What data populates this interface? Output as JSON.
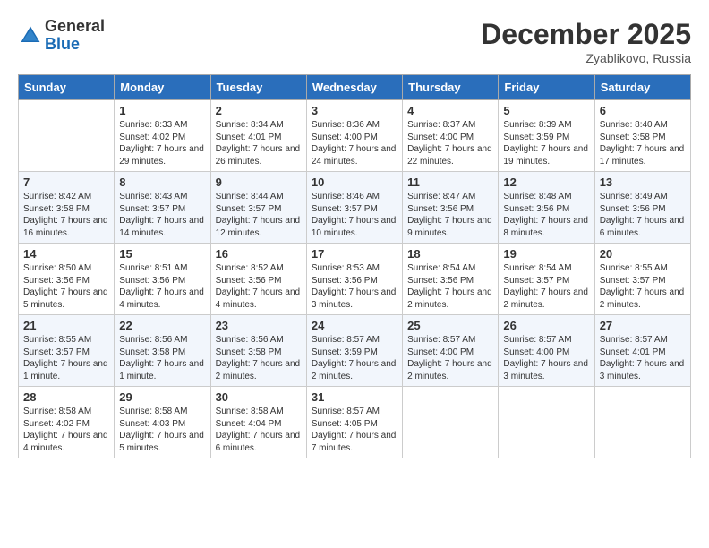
{
  "logo": {
    "general": "General",
    "blue": "Blue"
  },
  "title": "December 2025",
  "location": "Zyablikovo, Russia",
  "days_header": [
    "Sunday",
    "Monday",
    "Tuesday",
    "Wednesday",
    "Thursday",
    "Friday",
    "Saturday"
  ],
  "weeks": [
    [
      {
        "day": "",
        "sunrise": "",
        "sunset": "",
        "daylight": ""
      },
      {
        "day": "1",
        "sunrise": "Sunrise: 8:33 AM",
        "sunset": "Sunset: 4:02 PM",
        "daylight": "Daylight: 7 hours and 29 minutes."
      },
      {
        "day": "2",
        "sunrise": "Sunrise: 8:34 AM",
        "sunset": "Sunset: 4:01 PM",
        "daylight": "Daylight: 7 hours and 26 minutes."
      },
      {
        "day": "3",
        "sunrise": "Sunrise: 8:36 AM",
        "sunset": "Sunset: 4:00 PM",
        "daylight": "Daylight: 7 hours and 24 minutes."
      },
      {
        "day": "4",
        "sunrise": "Sunrise: 8:37 AM",
        "sunset": "Sunset: 4:00 PM",
        "daylight": "Daylight: 7 hours and 22 minutes."
      },
      {
        "day": "5",
        "sunrise": "Sunrise: 8:39 AM",
        "sunset": "Sunset: 3:59 PM",
        "daylight": "Daylight: 7 hours and 19 minutes."
      },
      {
        "day": "6",
        "sunrise": "Sunrise: 8:40 AM",
        "sunset": "Sunset: 3:58 PM",
        "daylight": "Daylight: 7 hours and 17 minutes."
      }
    ],
    [
      {
        "day": "7",
        "sunrise": "Sunrise: 8:42 AM",
        "sunset": "Sunset: 3:58 PM",
        "daylight": "Daylight: 7 hours and 16 minutes."
      },
      {
        "day": "8",
        "sunrise": "Sunrise: 8:43 AM",
        "sunset": "Sunset: 3:57 PM",
        "daylight": "Daylight: 7 hours and 14 minutes."
      },
      {
        "day": "9",
        "sunrise": "Sunrise: 8:44 AM",
        "sunset": "Sunset: 3:57 PM",
        "daylight": "Daylight: 7 hours and 12 minutes."
      },
      {
        "day": "10",
        "sunrise": "Sunrise: 8:46 AM",
        "sunset": "Sunset: 3:57 PM",
        "daylight": "Daylight: 7 hours and 10 minutes."
      },
      {
        "day": "11",
        "sunrise": "Sunrise: 8:47 AM",
        "sunset": "Sunset: 3:56 PM",
        "daylight": "Daylight: 7 hours and 9 minutes."
      },
      {
        "day": "12",
        "sunrise": "Sunrise: 8:48 AM",
        "sunset": "Sunset: 3:56 PM",
        "daylight": "Daylight: 7 hours and 8 minutes."
      },
      {
        "day": "13",
        "sunrise": "Sunrise: 8:49 AM",
        "sunset": "Sunset: 3:56 PM",
        "daylight": "Daylight: 7 hours and 6 minutes."
      }
    ],
    [
      {
        "day": "14",
        "sunrise": "Sunrise: 8:50 AM",
        "sunset": "Sunset: 3:56 PM",
        "daylight": "Daylight: 7 hours and 5 minutes."
      },
      {
        "day": "15",
        "sunrise": "Sunrise: 8:51 AM",
        "sunset": "Sunset: 3:56 PM",
        "daylight": "Daylight: 7 hours and 4 minutes."
      },
      {
        "day": "16",
        "sunrise": "Sunrise: 8:52 AM",
        "sunset": "Sunset: 3:56 PM",
        "daylight": "Daylight: 7 hours and 4 minutes."
      },
      {
        "day": "17",
        "sunrise": "Sunrise: 8:53 AM",
        "sunset": "Sunset: 3:56 PM",
        "daylight": "Daylight: 7 hours and 3 minutes."
      },
      {
        "day": "18",
        "sunrise": "Sunrise: 8:54 AM",
        "sunset": "Sunset: 3:56 PM",
        "daylight": "Daylight: 7 hours and 2 minutes."
      },
      {
        "day": "19",
        "sunrise": "Sunrise: 8:54 AM",
        "sunset": "Sunset: 3:57 PM",
        "daylight": "Daylight: 7 hours and 2 minutes."
      },
      {
        "day": "20",
        "sunrise": "Sunrise: 8:55 AM",
        "sunset": "Sunset: 3:57 PM",
        "daylight": "Daylight: 7 hours and 2 minutes."
      }
    ],
    [
      {
        "day": "21",
        "sunrise": "Sunrise: 8:55 AM",
        "sunset": "Sunset: 3:57 PM",
        "daylight": "Daylight: 7 hours and 1 minute."
      },
      {
        "day": "22",
        "sunrise": "Sunrise: 8:56 AM",
        "sunset": "Sunset: 3:58 PM",
        "daylight": "Daylight: 7 hours and 1 minute."
      },
      {
        "day": "23",
        "sunrise": "Sunrise: 8:56 AM",
        "sunset": "Sunset: 3:58 PM",
        "daylight": "Daylight: 7 hours and 2 minutes."
      },
      {
        "day": "24",
        "sunrise": "Sunrise: 8:57 AM",
        "sunset": "Sunset: 3:59 PM",
        "daylight": "Daylight: 7 hours and 2 minutes."
      },
      {
        "day": "25",
        "sunrise": "Sunrise: 8:57 AM",
        "sunset": "Sunset: 4:00 PM",
        "daylight": "Daylight: 7 hours and 2 minutes."
      },
      {
        "day": "26",
        "sunrise": "Sunrise: 8:57 AM",
        "sunset": "Sunset: 4:00 PM",
        "daylight": "Daylight: 7 hours and 3 minutes."
      },
      {
        "day": "27",
        "sunrise": "Sunrise: 8:57 AM",
        "sunset": "Sunset: 4:01 PM",
        "daylight": "Daylight: 7 hours and 3 minutes."
      }
    ],
    [
      {
        "day": "28",
        "sunrise": "Sunrise: 8:58 AM",
        "sunset": "Sunset: 4:02 PM",
        "daylight": "Daylight: 7 hours and 4 minutes."
      },
      {
        "day": "29",
        "sunrise": "Sunrise: 8:58 AM",
        "sunset": "Sunset: 4:03 PM",
        "daylight": "Daylight: 7 hours and 5 minutes."
      },
      {
        "day": "30",
        "sunrise": "Sunrise: 8:58 AM",
        "sunset": "Sunset: 4:04 PM",
        "daylight": "Daylight: 7 hours and 6 minutes."
      },
      {
        "day": "31",
        "sunrise": "Sunrise: 8:57 AM",
        "sunset": "Sunset: 4:05 PM",
        "daylight": "Daylight: 7 hours and 7 minutes."
      },
      {
        "day": "",
        "sunrise": "",
        "sunset": "",
        "daylight": ""
      },
      {
        "day": "",
        "sunrise": "",
        "sunset": "",
        "daylight": ""
      },
      {
        "day": "",
        "sunrise": "",
        "sunset": "",
        "daylight": ""
      }
    ]
  ]
}
